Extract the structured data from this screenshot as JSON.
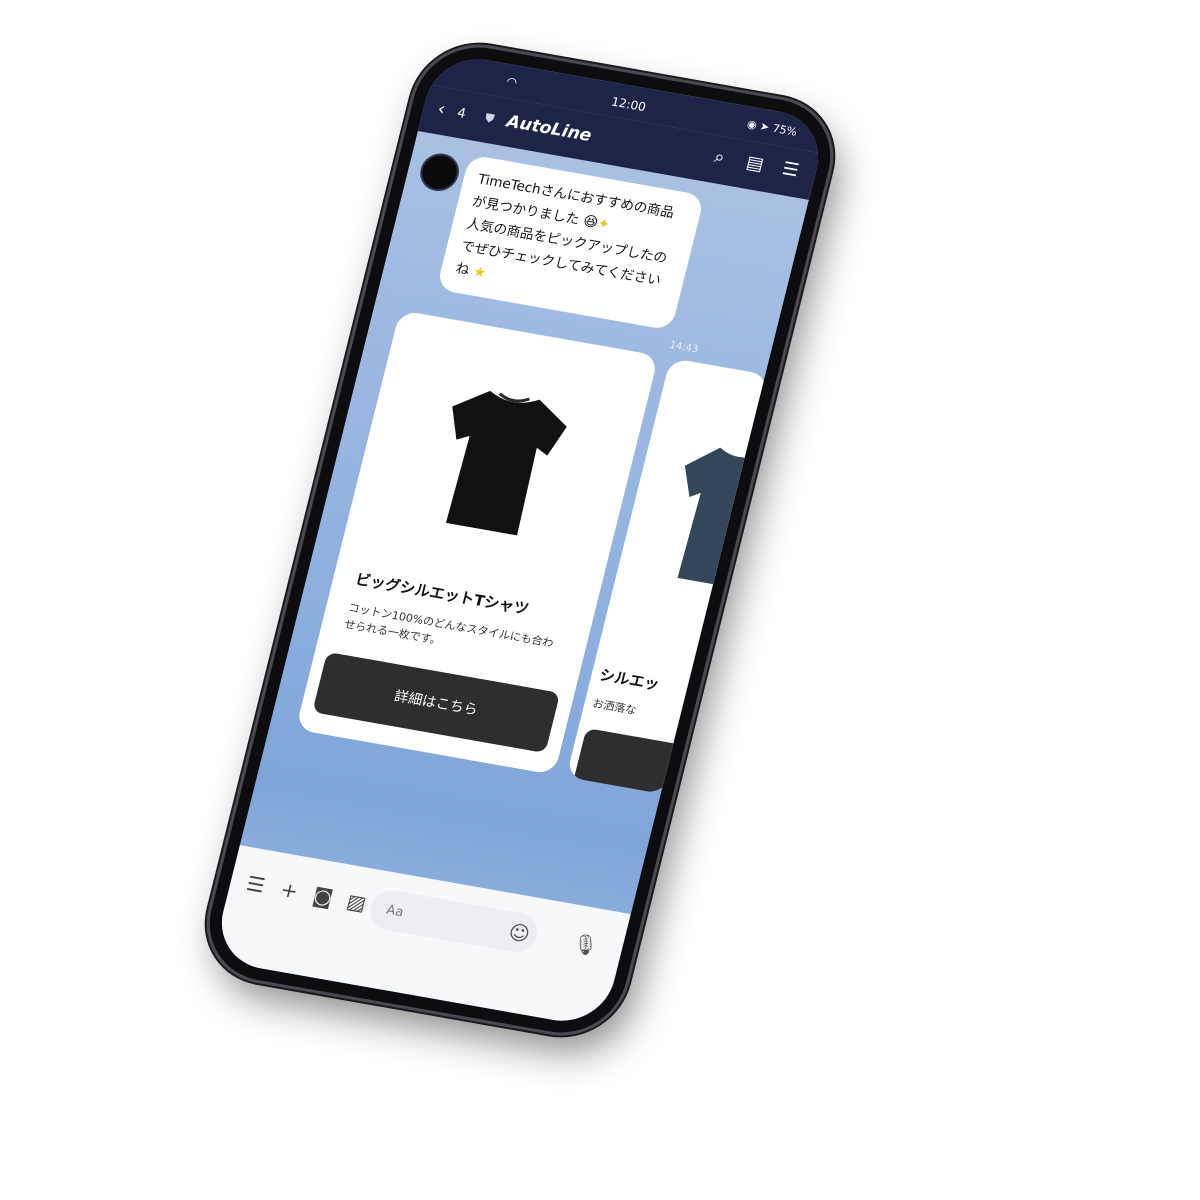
{
  "status": {
    "time": "12:00",
    "battery": "75%"
  },
  "nav": {
    "back_count": "4",
    "title": "AutoLine"
  },
  "message": {
    "line1": "TimeTechさんにおすすめの商品",
    "line2": "が見つかりました",
    "line3": "人気の商品をピックアップしたの",
    "line4": "でぜひチェックしてみてください",
    "line5": "ね",
    "time": "14:43"
  },
  "cards": [
    {
      "title": "ビッグシルエットTシャツ",
      "description": "コットン100%のどんなスタイルにも合わせられる一枚です。",
      "button": "詳細はこちら",
      "shirt_color": "#111111"
    },
    {
      "title": "シルエッ",
      "description": "お洒落な",
      "shirt_color": "#34465a"
    }
  ],
  "input": {
    "placeholder": "Aa"
  },
  "icons": [
    "menu-icon",
    "plus-icon",
    "camera-icon",
    "image-icon",
    "smile-icon",
    "mic-icon",
    "search-icon",
    "notes-icon",
    "hamburger-icon"
  ]
}
